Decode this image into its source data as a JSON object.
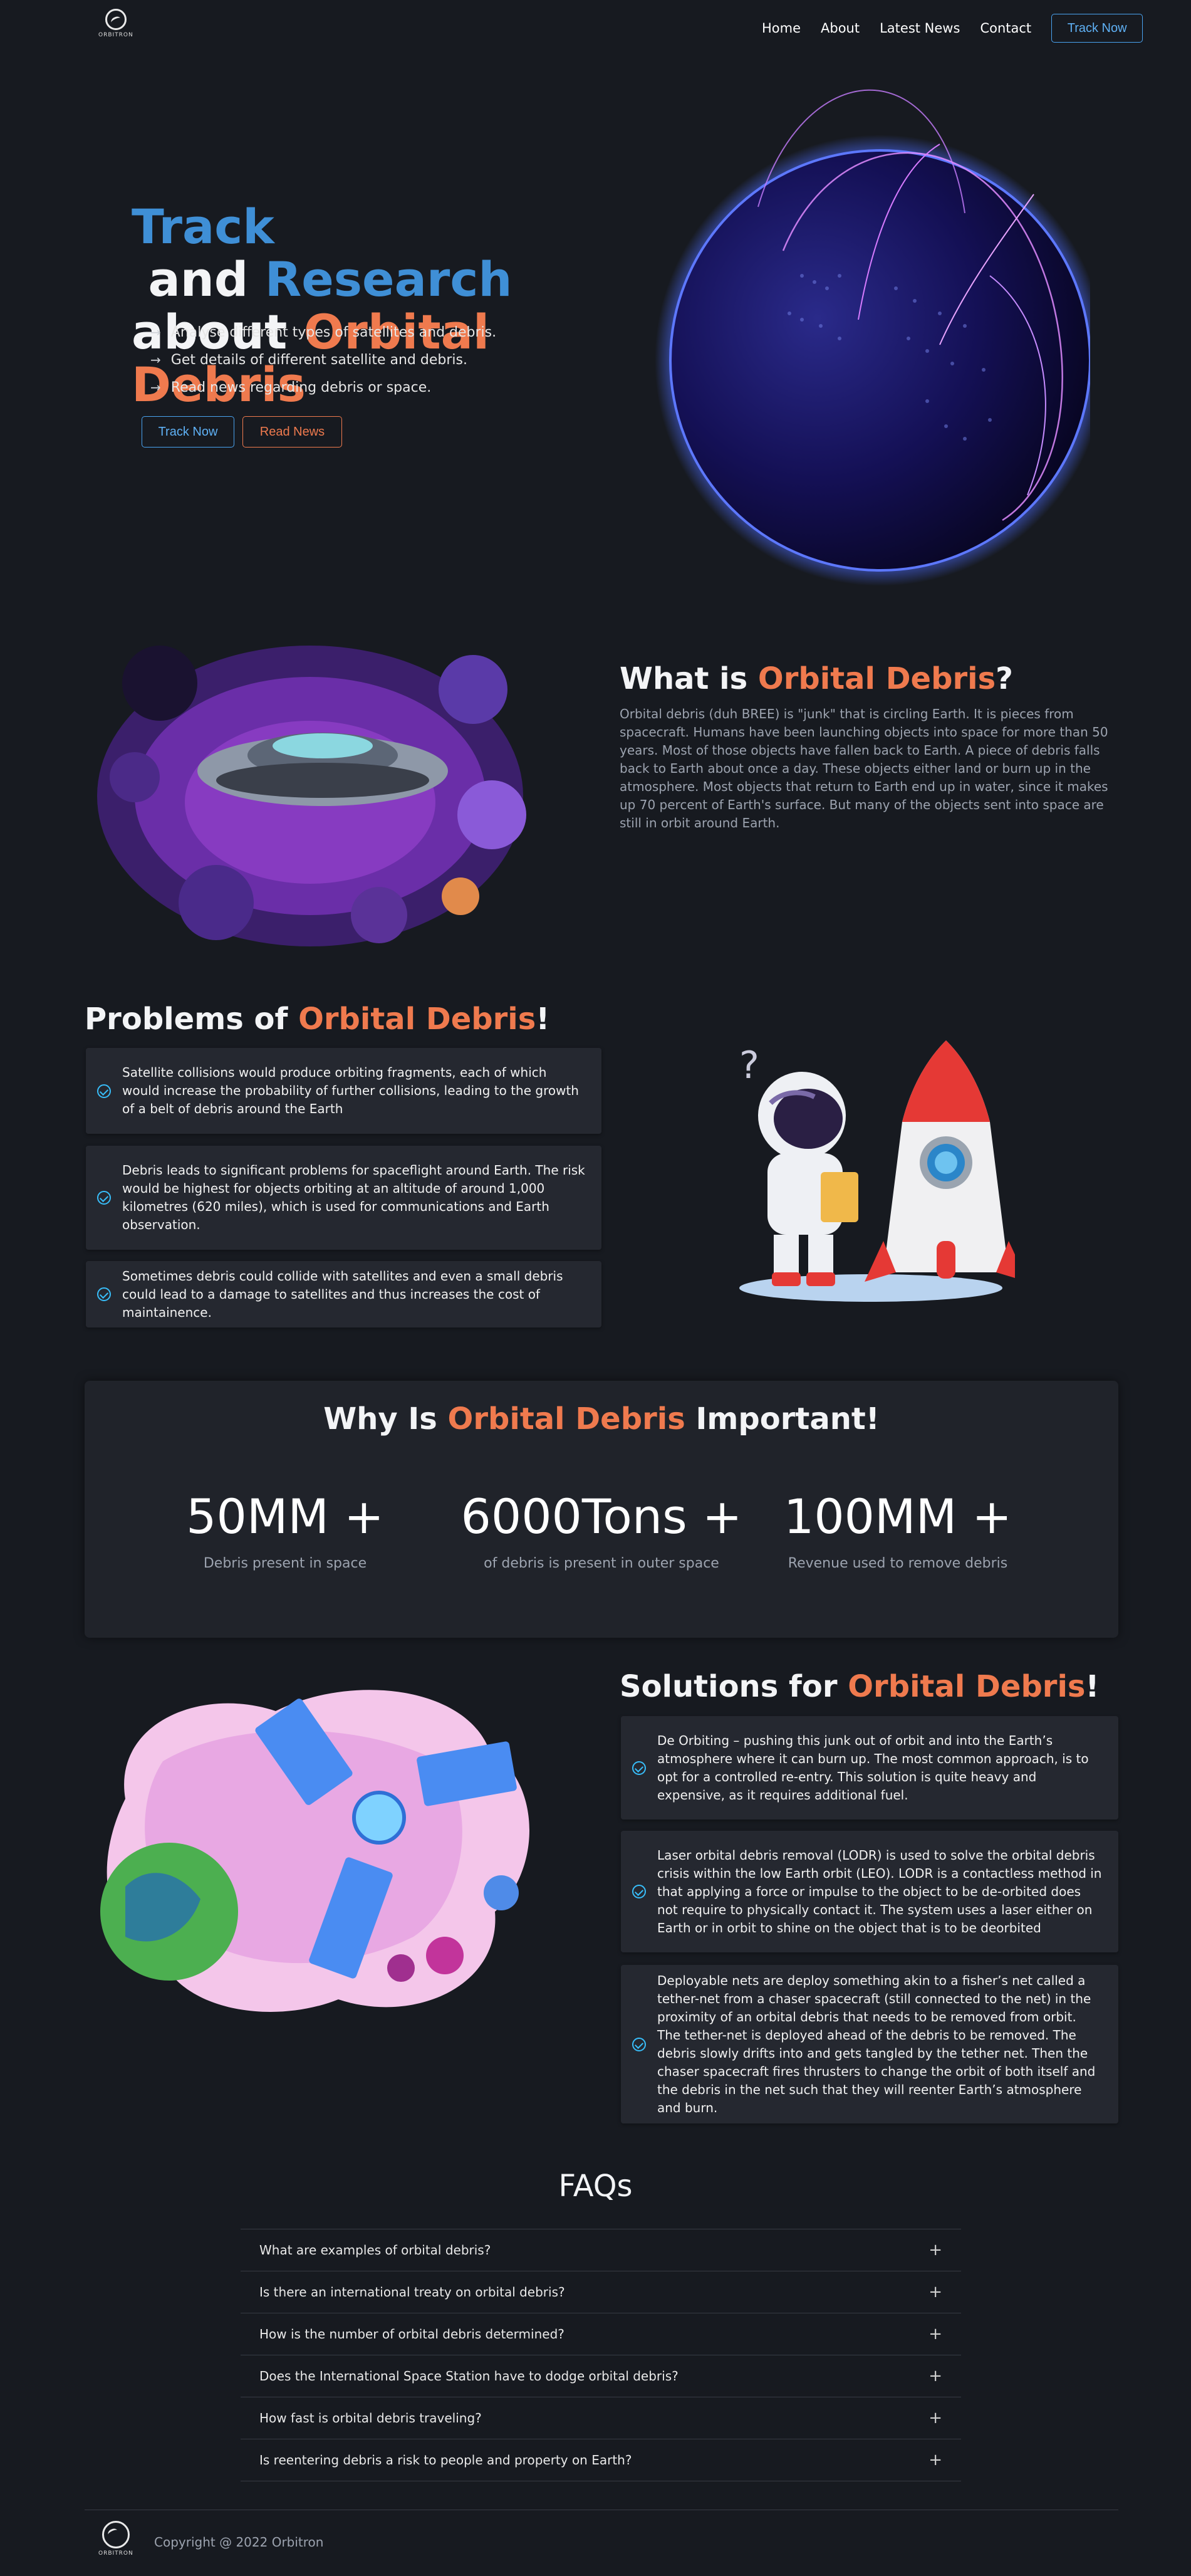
{
  "nav": {
    "logo_text": "ORBITRON",
    "links": [
      "Home",
      "About",
      "Latest News",
      "Contact"
    ],
    "cta": "Track Now"
  },
  "hero": {
    "title_part1": "Track",
    "title_part2": " and ",
    "title_part3": "Research",
    "title_part4": "about ",
    "title_part5": "Orbital Debris",
    "bullets": [
      "Analyse different types of satellites and debris.",
      "Get details of different satellite and debris.",
      "Read news regarding debris or space."
    ],
    "btn_track": "Track Now",
    "btn_news": "Read News"
  },
  "what": {
    "title_part1": "What is ",
    "title_part2": "Orbital Debris",
    "title_part3": "?",
    "text": "Orbital debris (duh BREE) is \"junk\" that is circling Earth. It is pieces from spacecraft. Humans have been launching objects into space for more than 50 years. Most of those objects have fallen back to Earth. A piece of debris falls back to Earth about once a day. These objects either land or burn up in the atmosphere. Most objects that return to Earth end up in water, since it makes up 70 percent of Earth's surface. But many of the objects sent into space are still in orbit around Earth."
  },
  "problems": {
    "title_part1": "Problems of ",
    "title_part2": "Orbital Debris",
    "title_part3": "!",
    "items": [
      "Satellite collisions would produce orbiting fragments, each of which would increase the probability of further collisions, leading to the growth of a belt of debris around the Earth",
      "Debris leads to significant problems for spaceflight around Earth. The risk would be highest for objects orbiting at an altitude of around 1,000 kilometres (620 miles), which is used for communications and Earth observation.",
      "Sometimes debris could collide with satellites and even a small debris could lead to a damage to satellites and thus increases the cost of maintainence."
    ]
  },
  "why": {
    "title_part1": "Why Is ",
    "title_part2": "Orbital Debris",
    "title_part3": " Important!",
    "stats": [
      {
        "value": "50MM +",
        "label": "Debris present in space"
      },
      {
        "value": "6000Tons +",
        "label": "of debris is present in outer space"
      },
      {
        "value": "100MM +",
        "label": "Revenue used to remove debris"
      }
    ]
  },
  "solutions": {
    "title_part1": "Solutions for ",
    "title_part2": "Orbital Debris",
    "title_part3": "!",
    "items": [
      "De Orbiting – pushing this junk out of orbit and into the Earth’s atmosphere where it can burn up. The most common approach, is to opt for a controlled re-entry. This solution is quite heavy and expensive, as it requires additional fuel.",
      "Laser orbital debris removal (LODR) is used to solve the orbital debris crisis within the low Earth orbit (LEO). LODR is a contactless method in that applying a force or impulse to the object to be de-orbited does not require to physically contact it. The system uses a laser either on Earth or in orbit to shine on the object that is to be deorbited",
      "Deployable nets are deploy something akin to a fisher’s net called a tether-net from a chaser spacecraft (still connected to the net) in the proximity of an orbital debris that needs to be removed from orbit. The tether-net is deployed ahead of the debris to be removed. The debris slowly drifts into and gets tangled by the tether net. Then the chaser spacecraft fires thrusters to change the orbit of both itself and the debris in the net such that they will reenter Earth’s atmosphere and burn."
    ]
  },
  "faq": {
    "title": "FAQs",
    "items": [
      "What are examples of orbital debris?",
      "Is there an international treaty on orbital debris?",
      "How is the number of orbital debris determined?",
      "Does the International Space Station have to dodge orbital debris?",
      "How fast is orbital debris traveling?",
      "Is reentering debris a risk to people and property on Earth?"
    ]
  },
  "footer": {
    "logo_text": "ORBITRON",
    "copyright": "Copyright @ 2022 Orbitron"
  }
}
